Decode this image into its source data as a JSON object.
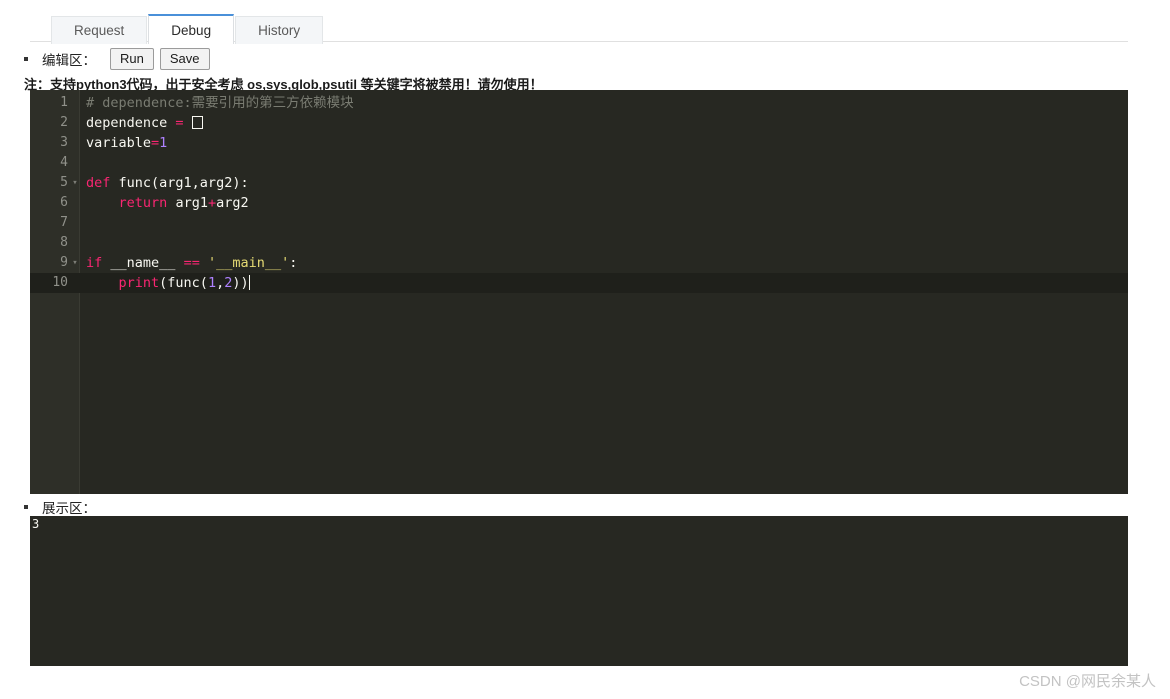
{
  "tabs": [
    {
      "label": "Request",
      "active": false
    },
    {
      "label": "Debug",
      "active": true
    },
    {
      "label": "History",
      "active": false
    }
  ],
  "editor_section": {
    "label": "编辑区：",
    "run_label": "Run",
    "save_label": "Save",
    "note": "注：支持python3代码，出于安全考虑 os,sys,glob,psutil 等关键字将被禁用！请勿使用！"
  },
  "code": {
    "lines": [
      {
        "num": "1",
        "fold": "",
        "active": false
      },
      {
        "num": "2",
        "fold": "",
        "active": false
      },
      {
        "num": "3",
        "fold": "",
        "active": false
      },
      {
        "num": "4",
        "fold": "",
        "active": false
      },
      {
        "num": "5",
        "fold": "▾",
        "active": false
      },
      {
        "num": "6",
        "fold": "",
        "active": false
      },
      {
        "num": "7",
        "fold": "",
        "active": false
      },
      {
        "num": "8",
        "fold": "",
        "active": false
      },
      {
        "num": "9",
        "fold": "▾",
        "active": false
      },
      {
        "num": "10",
        "fold": "",
        "active": true
      }
    ],
    "text": {
      "l1_comment": "# dependence:需要引用的第三方依赖模块",
      "l2_name": "dependence",
      "l2_eq": "=",
      "l3_name": "variable",
      "l3_eq": "=",
      "l3_num": "1",
      "l5_kw": "def",
      "l5_rest": "func(arg1,arg2):",
      "l6_kw": "return",
      "l6_a": "arg1",
      "l6_op": "+",
      "l6_b": "arg2",
      "l9_kw": "if",
      "l9_name": "__name__",
      "l9_op": "==",
      "l9_str": "'__main__'",
      "l9_colon": ":",
      "l10_fn": "print",
      "l10_p1": "(func(",
      "l10_n1": "1",
      "l10_comma": ",",
      "l10_n2": "2",
      "l10_p2": "))"
    },
    "colors": {
      "background": "#272822",
      "gutter": "#2e2f28",
      "active_line": "#1f201b",
      "keyword": "#f92672",
      "string": "#e6db74",
      "number": "#ae81ff",
      "comment": "#7a7c72",
      "text": "#f8f8f2",
      "line_number": "#90918a"
    }
  },
  "display_section": {
    "label": "展示区：",
    "output": "3"
  },
  "watermark": "CSDN @网民余某人",
  "theme": {
    "accent": "#4a90d9",
    "page_background": "#ffffff"
  }
}
